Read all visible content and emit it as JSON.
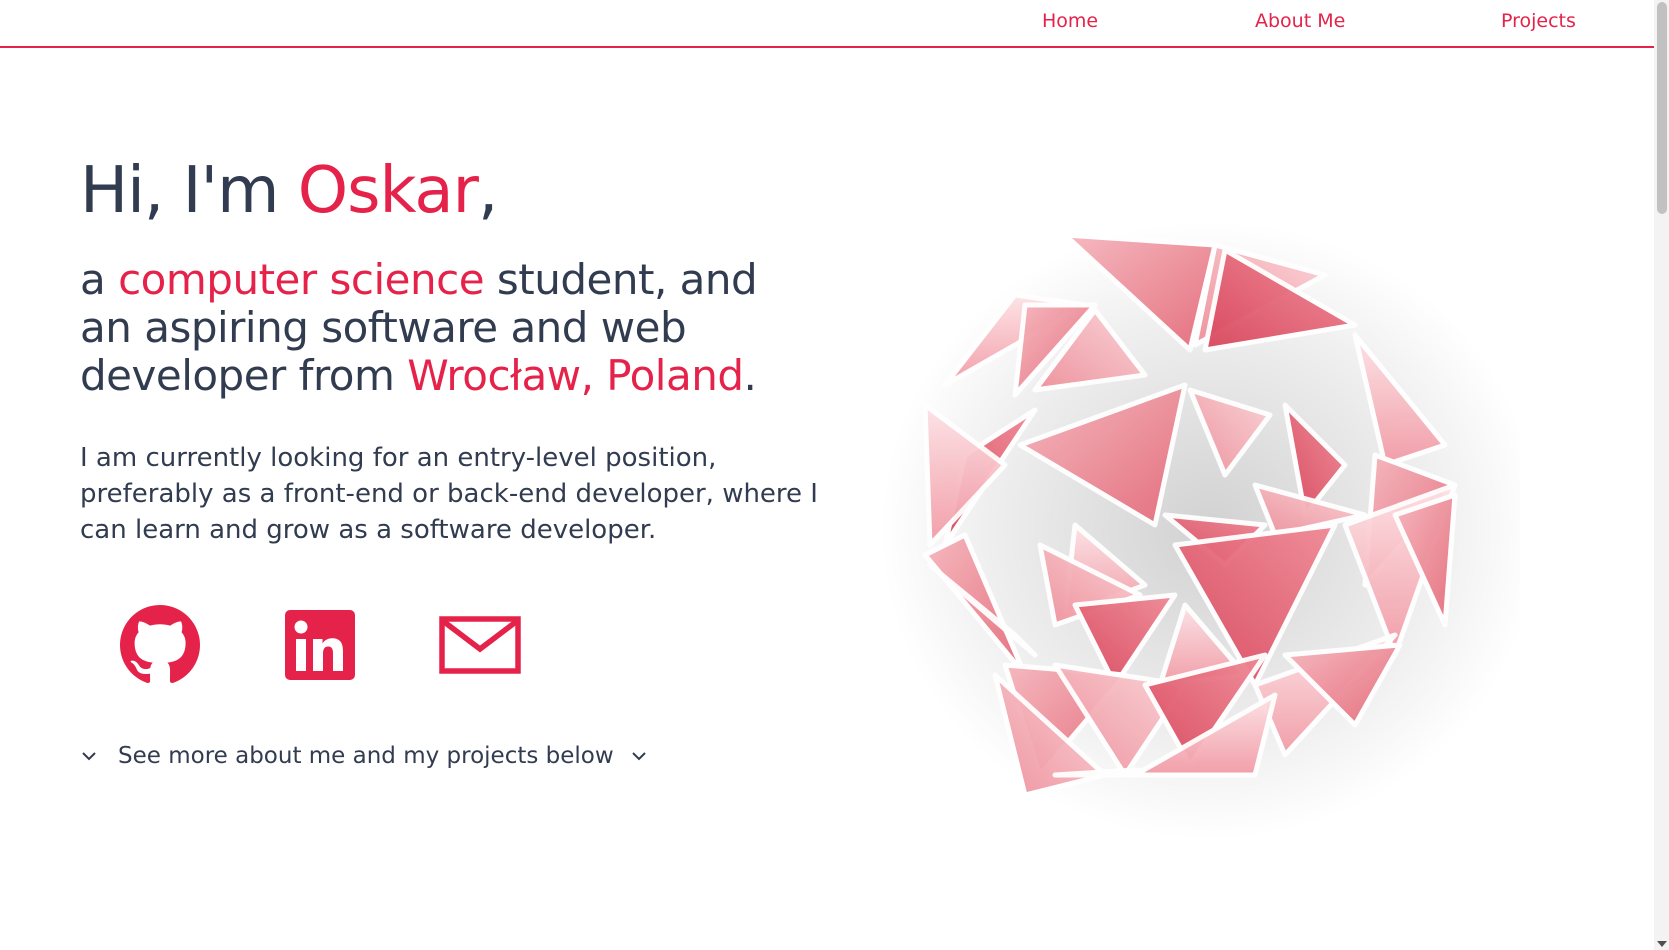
{
  "nav": {
    "items": [
      {
        "label": "Home"
      },
      {
        "label": "About Me"
      },
      {
        "label": "Projects"
      }
    ]
  },
  "hero": {
    "greeting_prefix": "Hi, I'm ",
    "name": "Oskar",
    "greeting_suffix": ",",
    "sub_1": "a ",
    "sub_field": "computer science",
    "sub_2": " student, and an aspiring software and web developer from ",
    "sub_location": "Wrocław, Poland",
    "sub_3": ".",
    "description": "I am currently looking for an entry-level position, preferably as a front-end or back-end developer, where I can learn and grow as a software developer.",
    "see_more": "See more about me and my projects below"
  },
  "socials": [
    {
      "icon": "github-icon"
    },
    {
      "icon": "linkedin-icon"
    },
    {
      "icon": "mail-icon"
    }
  ],
  "colors": {
    "accent": "#e5234a",
    "text": "#323c50",
    "background": "#ffffff"
  }
}
